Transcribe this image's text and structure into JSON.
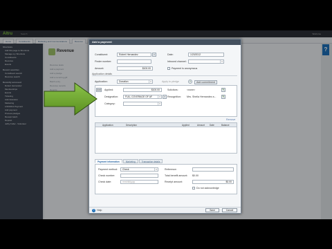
{
  "app": {
    "logo": "Altru",
    "search_placeholder": "Search",
    "user": "Welcome",
    "help_glyph": "?",
    "nav_tabs": [
      "Home",
      "Constituents",
      "Marketing and Communications",
      "Revenue",
      "Events",
      "Memberships",
      "Tickets",
      "Analysis",
      "Administration"
    ]
  },
  "sidebar": {
    "sections": [
      {
        "title": "Shortcuts",
        "items": [
          "Add this page to Shortcuts",
          "Manage my Shortcuts"
        ]
      },
      {
        "title": "",
        "items": [
          "Constituents",
          "Revenue",
          "Events"
        ]
      },
      {
        "title": "Recent searches",
        "items": [
          "Constituent search",
          "Revenue search"
        ]
      },
      {
        "title": "Recently accessed",
        "items": [
          "Robert Hernandez",
          "Memberships",
          "Events",
          "Ticketing",
          "Administration",
          "Marketing",
          "1/20/2012 Payment",
          "Add payment",
          "Process pledges",
          "Receipt batch",
          "Deposit",
          "Jeffry Fuller - Volunteer"
        ]
      }
    ]
  },
  "page": {
    "title": "Revenue",
    "ghost_items": [
      "Revenue tasks",
      "Add a payment",
      "Add a pledge",
      "Add a recurring gift",
      "Batch entry",
      "Revenue records",
      "Reports"
    ]
  },
  "modal": {
    "title": "Add a payment",
    "constituent_label": "Constituent:",
    "constituent_value": "Robert Hernandez",
    "date_label": "Date:",
    "date_value": "1/20/2012",
    "finder_label": "Finder number:",
    "finder_value": "",
    "channel_label": "Inbound channel:",
    "channel_value": "",
    "amount_label": "Amount:",
    "amount_value": "$100.00",
    "anonymous_label": "Payment is anonymous",
    "application_details": "Application details",
    "application_label": "Application:",
    "application_value": "Donation",
    "apply_label": "Apply to pledge",
    "add_commitment": "Add commitment",
    "add_btn": "Add",
    "applied_label": "Applied:",
    "applied_value": "$100.00",
    "designation_label": "Designation:",
    "designation_value": "FULL COVERAGE OF AF",
    "category_label": "Category:",
    "category_value": "",
    "solicitors_label": "Solicitors:",
    "solicitors_value": "<none>",
    "recognition_label": "Recognition:",
    "recognition_value": "Mrs. Sheila Hernandez a...",
    "remove_label": "Remove",
    "grid_headers": [
      "Application",
      "Description",
      "Applied",
      "Amount",
      "Date",
      "Balance"
    ],
    "subtabs": [
      "Payment information",
      "Marketing",
      "Transaction details"
    ],
    "payment_method_label": "Payment method:",
    "payment_method_value": "Check",
    "check_number_label": "Check number:",
    "check_number_value": "",
    "check_date_label": "Check date:",
    "check_date_value": "mm/dd/yyyy",
    "reference_label": "Reference:",
    "reference_value": "",
    "benefit_label": "Total benefit amount:",
    "benefit_value": "$0.00",
    "receipt_label": "Receipt amount:",
    "receipt_value": "$0.00",
    "no_ack_label": "Do not acknowledge",
    "help_label": "Help",
    "save_label": "Save",
    "cancel_label": "Cancel"
  },
  "colors": {
    "arrow": "#5a8f1f",
    "arrow_light": "#8bc34a",
    "header": "#44505e",
    "accent": "#1d6fb8"
  }
}
